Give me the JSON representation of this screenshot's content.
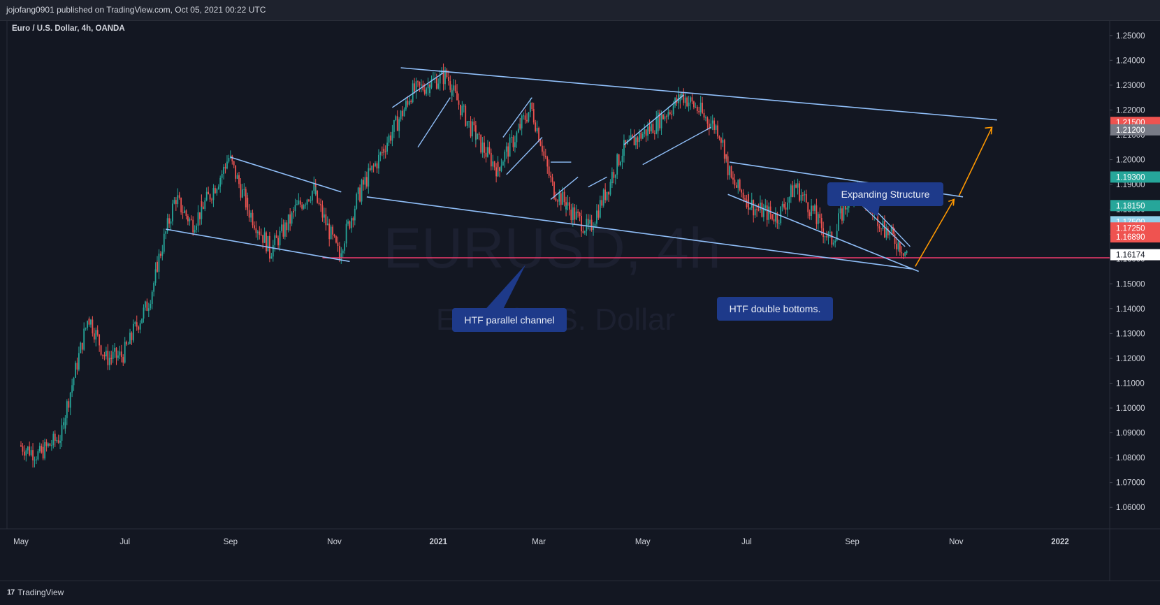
{
  "header": {
    "text": "jojofang0901 published on TradingView.com, Oct 05, 2021 00:22 UTC"
  },
  "symbol": {
    "label": "Euro / U.S. Dollar, 4h, OANDA"
  },
  "watermark": {
    "ticker": "EURUSD, 4h",
    "name": "Euro / U.S. Dollar"
  },
  "footer": {
    "brand": "TradingView",
    "logo_icon": "tradingview-logo-icon"
  },
  "colors": {
    "background": "#131722",
    "up_candle": "#26a69a",
    "down_candle": "#ef5350",
    "trendline": "#90bff9",
    "support_line": "#f23a6c",
    "projection": "#ff9800",
    "callout": "#1e3a8a",
    "last_price_box": "#ffffff"
  },
  "annotations": {
    "channel": "HTF parallel channel",
    "double_bottom": "HTF double bottoms.",
    "expanding": "Expanding Structure"
  },
  "chart_data": {
    "type": "candlestick",
    "title": "Euro / U.S. Dollar, 4h, OANDA",
    "x_labels": [
      "May",
      "Jul",
      "Sep",
      "Nov",
      "2021",
      "Mar",
      "May",
      "Jul",
      "Sep",
      "Nov",
      "2022"
    ],
    "x_label_dates": [
      "2020-05-01",
      "2020-07-01",
      "2020-09-01",
      "2020-11-01",
      "2021-01-01",
      "2021-03-01",
      "2021-05-01",
      "2021-07-01",
      "2021-09-01",
      "2021-11-01",
      "2022-01-01"
    ],
    "y_ticks": [
      "1.25000",
      "1.24000",
      "1.23000",
      "1.22000",
      "1.21000",
      "1.20000",
      "1.19000",
      "1.18000",
      "1.17000",
      "1.16000",
      "1.15000",
      "1.14000",
      "1.13000",
      "1.12000",
      "1.11000",
      "1.10000",
      "1.09000",
      "1.08000",
      "1.07000",
      "1.06000"
    ],
    "ylim": [
      1.055,
      1.255
    ],
    "price_tags": [
      {
        "label": "1.21500",
        "value": 1.215,
        "color": "#ef5350"
      },
      {
        "label": "1.21200",
        "value": 1.212,
        "color": "#787b86"
      },
      {
        "label": "1.19300",
        "value": 1.193,
        "color": "#26a69a"
      },
      {
        "label": "1.18150",
        "value": 1.1815,
        "color": "#26a69a"
      },
      {
        "label": "1.17500",
        "value": 1.175,
        "color": "#8fd0e9"
      },
      {
        "label": "1.17250",
        "value": 1.1725,
        "color": "#ef5350"
      },
      {
        "label": "1.16890",
        "value": 1.1689,
        "color": "#ef5350"
      },
      {
        "label": "1.16174",
        "value": 1.16174,
        "color": "#ffffff"
      }
    ],
    "price_path": [
      [
        "2020-05-01",
        1.085
      ],
      [
        "2020-05-12",
        1.081
      ],
      [
        "2020-05-25",
        1.089
      ],
      [
        "2020-06-10",
        1.138
      ],
      [
        "2020-06-20",
        1.12
      ],
      [
        "2020-06-30",
        1.121
      ],
      [
        "2020-07-15",
        1.142
      ],
      [
        "2020-07-31",
        1.185
      ],
      [
        "2020-08-10",
        1.174
      ],
      [
        "2020-08-20",
        1.185
      ],
      [
        "2020-09-01",
        1.201
      ],
      [
        "2020-09-10",
        1.183
      ],
      [
        "2020-09-25",
        1.163
      ],
      [
        "2020-10-10",
        1.18
      ],
      [
        "2020-10-20",
        1.188
      ],
      [
        "2020-11-04",
        1.161
      ],
      [
        "2020-11-15",
        1.185
      ],
      [
        "2020-12-01",
        1.205
      ],
      [
        "2020-12-17",
        1.227
      ],
      [
        "2021-01-06",
        1.234
      ],
      [
        "2021-01-20",
        1.213
      ],
      [
        "2021-02-05",
        1.196
      ],
      [
        "2021-02-25",
        1.221
      ],
      [
        "2021-03-10",
        1.188
      ],
      [
        "2021-03-31",
        1.171
      ],
      [
        "2021-04-20",
        1.204
      ],
      [
        "2021-05-10",
        1.215
      ],
      [
        "2021-05-25",
        1.226
      ],
      [
        "2021-06-15",
        1.212
      ],
      [
        "2021-06-23",
        1.191
      ],
      [
        "2021-07-07",
        1.18
      ],
      [
        "2021-07-20",
        1.177
      ],
      [
        "2021-07-30",
        1.19
      ],
      [
        "2021-08-20",
        1.167
      ],
      [
        "2021-09-03",
        1.19
      ],
      [
        "2021-09-20",
        1.173
      ],
      [
        "2021-10-04",
        1.1617
      ]
    ],
    "trendlines": [
      {
        "name": "htf-channel-top",
        "from": [
          "2020-12-10",
          1.237
        ],
        "to": [
          "2021-11-25",
          1.216
        ]
      },
      {
        "name": "htf-channel-bottom",
        "from": [
          "2020-11-20",
          1.185
        ],
        "to": [
          "2021-10-06",
          1.156
        ]
      },
      {
        "name": "falling-wedge-top",
        "from": [
          "2020-09-01",
          1.201
        ],
        "to": [
          "2020-11-05",
          1.187
        ]
      },
      {
        "name": "falling-wedge-bottom",
        "from": [
          "2020-07-25",
          1.172
        ],
        "to": [
          "2020-11-10",
          1.159
        ]
      },
      {
        "name": "expanding-top",
        "from": [
          "2021-06-21",
          1.199
        ],
        "to": [
          "2021-11-05",
          1.185
        ]
      },
      {
        "name": "expanding-bottom",
        "from": [
          "2021-06-20",
          1.186
        ],
        "to": [
          "2021-10-10",
          1.155
        ]
      }
    ],
    "support_level": 1.1605,
    "projection_path": [
      [
        "2021-10-08",
        1.157
      ],
      [
        "2021-11-01",
        1.184
      ],
      [
        "2021-11-22",
        1.213
      ]
    ],
    "last_price": 1.16174
  }
}
